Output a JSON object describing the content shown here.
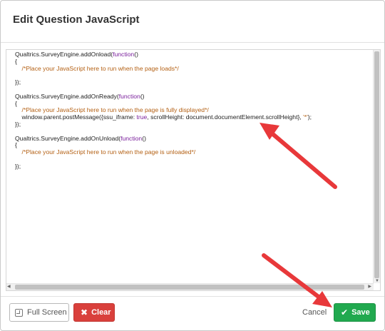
{
  "dialog": {
    "title": "Edit Question JavaScript"
  },
  "editor": {
    "lines": [
      [
        {
          "t": "Qualtrics.SurveyEngine.addOnload(",
          "c": "pl"
        },
        {
          "t": "function",
          "c": "kw"
        },
        {
          "t": "()",
          "c": "pl"
        }
      ],
      [
        {
          "t": "{",
          "c": "pl"
        }
      ],
      [
        {
          "t": "    /*Place your JavaScript here to run when the page loads*/",
          "c": "cm"
        }
      ],
      [],
      [
        {
          "t": "});",
          "c": "pl"
        }
      ],
      [],
      [
        {
          "t": "Qualtrics.SurveyEngine.addOnReady(",
          "c": "pl"
        },
        {
          "t": "function",
          "c": "kw"
        },
        {
          "t": "()",
          "c": "pl"
        }
      ],
      [
        {
          "t": "{",
          "c": "pl"
        }
      ],
      [
        {
          "t": "    /*Place your JavaScript here to run when the page is fully displayed*/",
          "c": "cm"
        }
      ],
      [
        {
          "t": "    window.parent.postMessage({ssu_iframe: ",
          "c": "pl"
        },
        {
          "t": "true",
          "c": "kw"
        },
        {
          "t": ", scrollHeight: document.documentElement.scrollHeight}, ",
          "c": "pl"
        },
        {
          "t": "'*'",
          "c": "cm"
        },
        {
          "t": ");",
          "c": "pl"
        }
      ],
      [
        {
          "t": "});",
          "c": "pl"
        }
      ],
      [],
      [
        {
          "t": "Qualtrics.SurveyEngine.addOnUnload(",
          "c": "pl"
        },
        {
          "t": "function",
          "c": "kw"
        },
        {
          "t": "()",
          "c": "pl"
        }
      ],
      [
        {
          "t": "{",
          "c": "pl"
        }
      ],
      [
        {
          "t": "    /*Place your JavaScript here to run when the page is unloaded*/",
          "c": "cm"
        }
      ],
      [],
      [
        {
          "t": "});",
          "c": "pl"
        }
      ]
    ]
  },
  "footer": {
    "fullscreen_label": "Full Screen",
    "clear_label": "Clear",
    "cancel_label": "Cancel",
    "save_label": "Save"
  },
  "colors": {
    "save": "#21a94f",
    "clear": "#d9403c",
    "keyword": "#7a1f9c",
    "comment": "#b35f12",
    "annotation_arrow": "#e8383a"
  },
  "icons": {
    "fullscreen": "fullscreen-icon",
    "clear": "x-icon",
    "save": "check-icon"
  }
}
